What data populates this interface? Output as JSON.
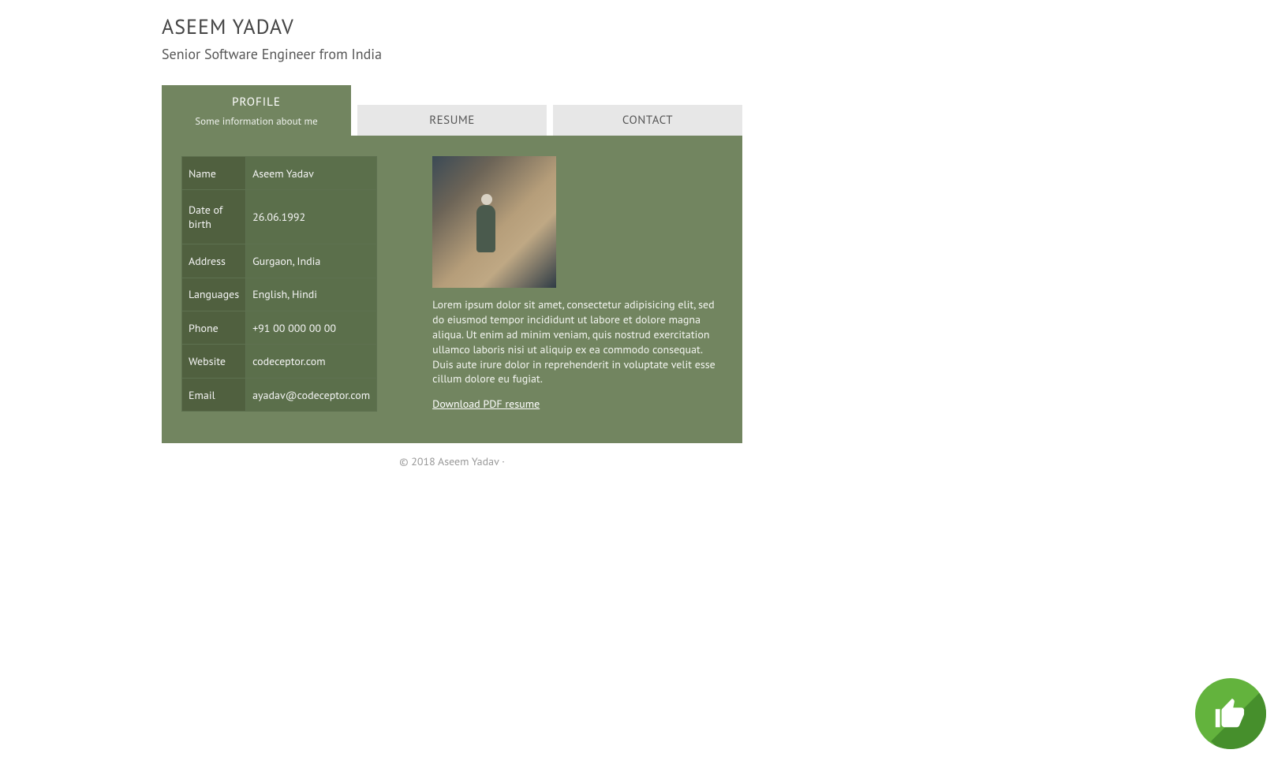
{
  "header": {
    "title": "ASEEM YADAV",
    "subtitle": "Senior Software Engineer from India"
  },
  "tabs": {
    "active": {
      "title": "PROFILE",
      "sub": "Some information about me"
    },
    "resume": "RESUME",
    "contact": "CONTACT"
  },
  "info": {
    "rows": [
      {
        "k": "Name",
        "v": "Aseem Yadav"
      },
      {
        "k": "Date of birth",
        "v": "26.06.1992"
      },
      {
        "k": "Address",
        "v": "Gurgaon, India"
      },
      {
        "k": "Languages",
        "v": "English, Hindi"
      },
      {
        "k": "Phone",
        "v": "+91 00 000 00 00"
      },
      {
        "k": "Website",
        "v": "codeceptor.com"
      },
      {
        "k": "Email",
        "v": "ayadav@codeceptor.com"
      }
    ]
  },
  "bio": "Lorem ipsum dolor sit amet, consectetur adipisicing elit, sed do eiusmod tempor incididunt ut labore et dolore magna aliqua. Ut enim ad minim veniam, quis nostrud exercitation ullamco laboris nisi ut aliquip ex ea commodo consequat. Duis aute irure dolor in reprehenderit in voluptate velit esse cillum dolore eu fugiat.",
  "download": "Download PDF resume",
  "footer": "© 2018 Aseem Yadav ·",
  "badge": {
    "icon": "thumbs-up-icon"
  }
}
